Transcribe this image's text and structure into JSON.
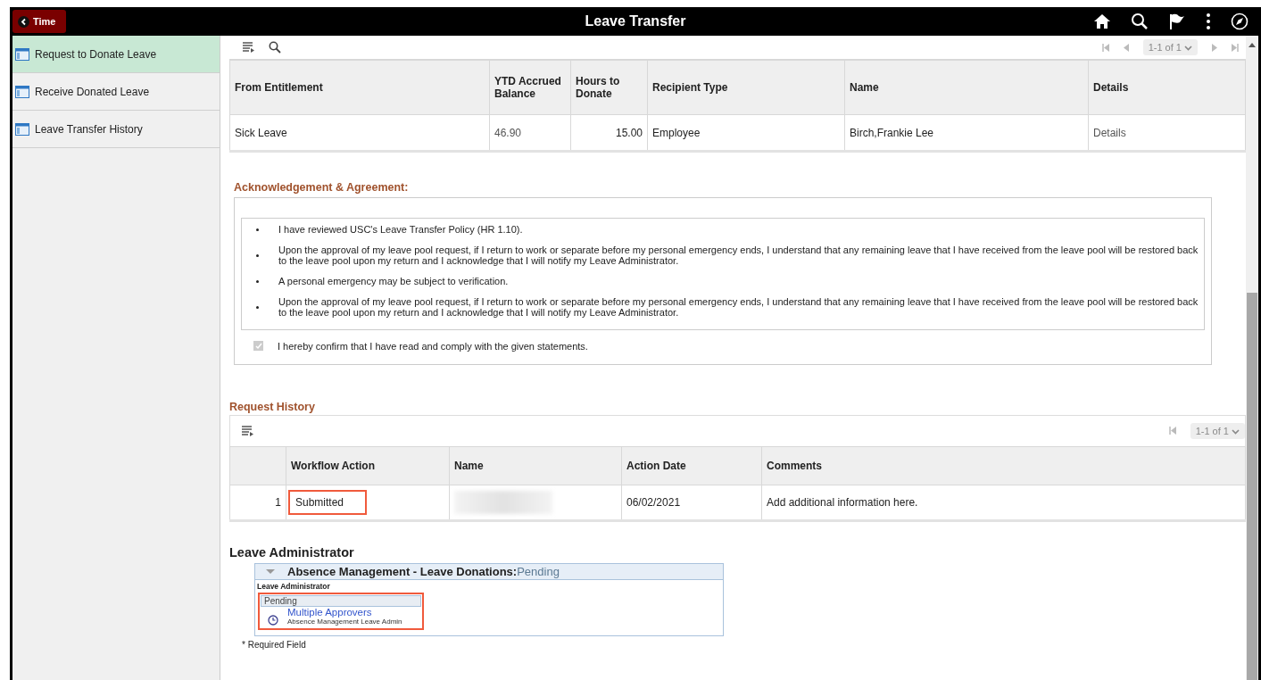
{
  "header": {
    "back_button": "Time",
    "title": "Leave Transfer"
  },
  "sidebar": {
    "items": [
      {
        "label": "Request to Donate Leave",
        "selected": true
      },
      {
        "label": "Receive Donated Leave",
        "selected": false
      },
      {
        "label": "Leave Transfer History",
        "selected": false
      }
    ]
  },
  "donation_grid": {
    "pager": "1-1 of 1",
    "columns": [
      "From Entitlement",
      "YTD Accrued Balance",
      "Hours to Donate",
      "Recipient Type",
      "Name",
      "Details"
    ],
    "rows": [
      {
        "from_entitlement": "Sick Leave",
        "ytd_accrued_balance": "46.90",
        "hours_to_donate": "15.00",
        "recipient_type": "Employee",
        "name": "Birch,Frankie Lee",
        "details": "Details"
      }
    ]
  },
  "acknowledgement": {
    "title": "Acknowledgement & Agreement:",
    "statements": [
      "I have reviewed USC's Leave Transfer Policy (HR 1.10).",
      "Upon the approval of my leave pool request, if I return to work or separate before my personal emergency ends, I understand that any remaining leave that I have received from the leave pool will be restored back to the leave pool upon my return and I acknowledge that I will notify my Leave Administrator.",
      "A personal emergency may be subject to verification.",
      "Upon the approval of my leave pool request, if I return to work or separate before my personal emergency ends, I understand that any remaining leave that I have received from the leave pool will be restored back to the leave pool upon my return and I acknowledge that I will notify my Leave Administrator."
    ],
    "confirm": {
      "label": "I hereby confirm that I have read and comply with the given statements.",
      "checked": true,
      "disabled": true
    }
  },
  "request_history": {
    "title": "Request History",
    "pager": "1-1 of 1",
    "columns": [
      "Workflow Action",
      "Name",
      "Action Date",
      "Comments"
    ],
    "rows": [
      {
        "number": "1",
        "workflow_action": "Submitted",
        "highlighted": true,
        "action_date": "06/02/2021",
        "comments": "Add additional information here."
      }
    ]
  },
  "leave_administrator": {
    "title": "Leave Administrator",
    "workflow": "Absence Management - Leave Donations:",
    "status": "Pending",
    "role": "Leave Administrator",
    "step": {
      "status": "Pending",
      "approver": "Multiple Approvers",
      "approver_role": "Absence Management Leave Admin",
      "highlighted": true
    }
  },
  "footer_note": "* Required Field"
}
